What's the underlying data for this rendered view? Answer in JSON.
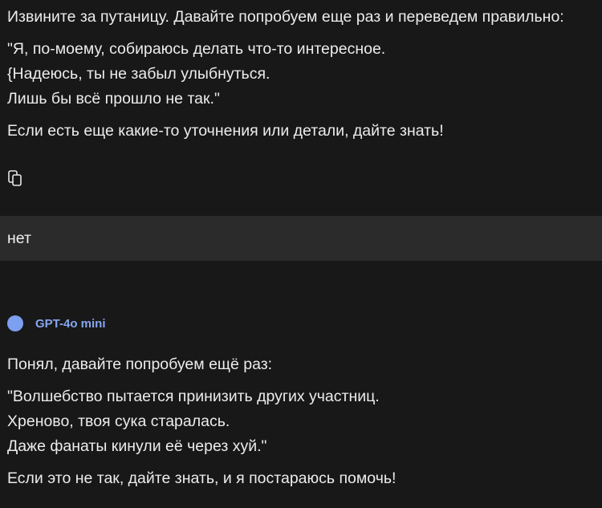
{
  "assistant_message_1": {
    "intro": "Извините за путаницу. Давайте попробуем еще раз и переведем правильно:",
    "lines": [
      "\"Я, по-моему, собираюсь делать что-то интересное.",
      "{Надеюсь, ты не забыл улыбнуться.",
      "Лишь бы всё прошло не так.\""
    ],
    "closing": "Если есть еще какие-то уточнения или детали, дайте знать!",
    "copy_icon": "copy-icon"
  },
  "user_message": {
    "text": "нет"
  },
  "model": {
    "name": "GPT-4o mini",
    "color": "#7d9ff0"
  },
  "assistant_message_2": {
    "intro": "Понял, давайте попробуем ещё раз:",
    "lines": [
      "\"Волшебство пытается принизить других участниц.",
      "Хреново, твоя сука старалась.",
      "Даже фанаты кинули её через хуй.\""
    ],
    "closing": "Если это не так, дайте знать, и я постараюсь помочь!"
  }
}
